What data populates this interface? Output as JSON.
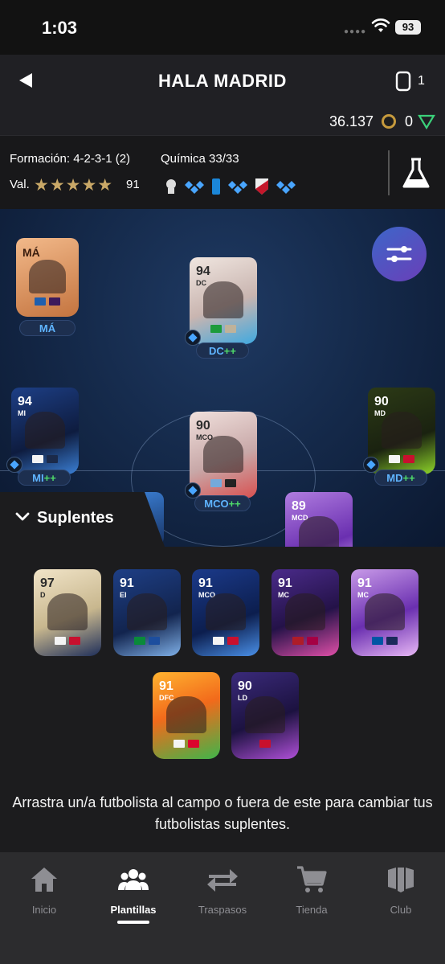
{
  "status_bar": {
    "time": "1:03",
    "battery": "93"
  },
  "header": {
    "title": "HALA MADRID",
    "squad_count": "1",
    "coins": "36.137",
    "points": "0"
  },
  "squad_info": {
    "formation": "Formación: 4-2-3-1 (2)",
    "chemistry": "Química 33/33",
    "value_label": "Val.",
    "stars": "★★★★★",
    "value": "91"
  },
  "manager": {
    "label": "MÁ",
    "pill": "MÁ"
  },
  "pitch_players": [
    {
      "rating": "94",
      "position": "DC",
      "pill": "DC",
      "plus": "++"
    },
    {
      "rating": "94",
      "position": "MI",
      "pill": "MI",
      "plus": "++"
    },
    {
      "rating": "90",
      "position": "MCO",
      "pill": "MCO",
      "plus": "++"
    },
    {
      "rating": "90",
      "position": "MD",
      "pill": "MD",
      "plus": "++"
    },
    {
      "rating": "89",
      "position": "MCD"
    }
  ],
  "bench": {
    "title": "Suplentes",
    "players": [
      {
        "rating": "97",
        "position": "D"
      },
      {
        "rating": "91",
        "position": "EI"
      },
      {
        "rating": "91",
        "position": "MCO"
      },
      {
        "rating": "91",
        "position": "MC"
      },
      {
        "rating": "91",
        "position": "MC"
      },
      {
        "rating": "91",
        "position": "DFC"
      },
      {
        "rating": "90",
        "position": "LD"
      }
    ],
    "hint": "Arrastra un/a futbolista al campo o fuera de este para cambiar tus futbolistas suplentes."
  },
  "tabs": [
    {
      "label": "Inicio",
      "icon": "home-icon"
    },
    {
      "label": "Plantillas",
      "icon": "people-icon",
      "active": true
    },
    {
      "label": "Traspasos",
      "icon": "transfer-arrows-icon"
    },
    {
      "label": "Tienda",
      "icon": "cart-icon"
    },
    {
      "label": "Club",
      "icon": "club-shield-icon"
    }
  ],
  "colors": {
    "accent": "#5fb4ff",
    "plus_green": "#4fdc6a",
    "star_gold": "#c9a867"
  }
}
